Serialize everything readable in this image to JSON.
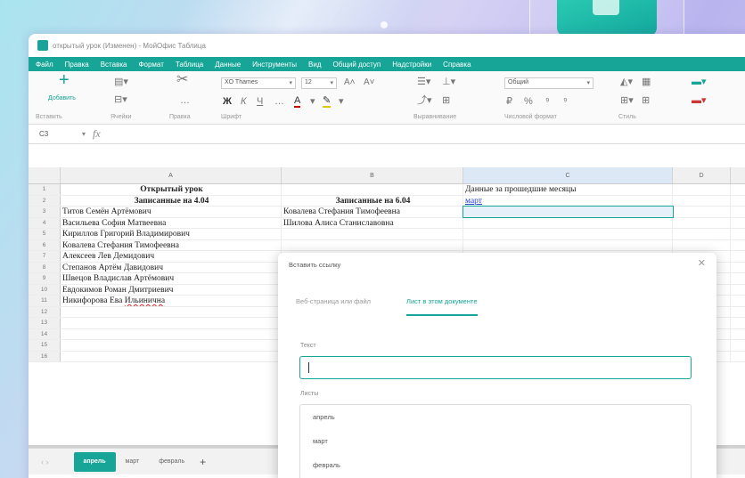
{
  "window_title": "открытый урок (Изменен) - МойОфис Таблица",
  "menu": [
    "Файл",
    "Правка",
    "Вставка",
    "Формат",
    "Таблица",
    "Данные",
    "Инструменты",
    "Вид",
    "Общий доступ",
    "Надстройки",
    "Справка"
  ],
  "ribbon": {
    "add_label": "Добавить",
    "font_name": "XO Thames",
    "font_size": "12",
    "number_format": "Общий",
    "groups": {
      "insert": "Вставить",
      "cells": "Ячейки",
      "clipboard": "Правка",
      "font": "Шрифт",
      "alignment": "Выравнивание",
      "number": "Числовой формат",
      "style": "Стиль"
    }
  },
  "formula_bar": {
    "cell_ref": "C3",
    "fx": "fx"
  },
  "columns": [
    "A",
    "B",
    "C",
    "D"
  ],
  "rows": [
    {
      "n": "1",
      "a": "Открытый урок",
      "b": "",
      "c": "Данные за прошедшие месяцы",
      "a_bold": true
    },
    {
      "n": "2",
      "a": "Записанные на 4.04",
      "b": "Записанные  на 6.04",
      "c": "март",
      "a_bold": true,
      "b_bold": true,
      "c_link": true
    },
    {
      "n": "3",
      "a": "Титов Семён Артёмович",
      "b": "Ковалева Стефания Тимофеевна",
      "c": "",
      "c_sel": true
    },
    {
      "n": "4",
      "a": "Васильева София Матвеевна",
      "b": "Шилова Алиса Станиславовна",
      "c": ""
    },
    {
      "n": "5",
      "a": "Кириллов Григорий Владимирович",
      "b": "",
      "c": ""
    },
    {
      "n": "6",
      "a": "Ковалева Стефания Тимофеевна",
      "b": "",
      "c": ""
    },
    {
      "n": "7",
      "a": "Алексеев Лев Демидович",
      "b": "",
      "c": ""
    },
    {
      "n": "8",
      "a": "Степанов Артём Давидович",
      "b": "",
      "c": ""
    },
    {
      "n": "9",
      "a": "Швецов Владислав Артёмович",
      "b": "",
      "c": ""
    },
    {
      "n": "10",
      "a": "Евдокимов Роман Дмитриевич",
      "b": "",
      "c": ""
    },
    {
      "n": "11",
      "a": "Никифорова Ева ",
      "a_err": "Ильинична",
      "b": "",
      "c": ""
    },
    {
      "n": "12",
      "a": "",
      "b": "",
      "c": ""
    },
    {
      "n": "13",
      "a": "",
      "b": "",
      "c": ""
    },
    {
      "n": "14",
      "a": "",
      "b": "",
      "c": ""
    },
    {
      "n": "15",
      "a": "",
      "b": "",
      "c": ""
    },
    {
      "n": "16",
      "a": "",
      "b": "",
      "c": ""
    }
  ],
  "sheets": [
    {
      "name": "апрель",
      "active": true
    },
    {
      "name": "март",
      "active": false
    },
    {
      "name": "февраль",
      "active": false
    }
  ],
  "add_sheet": "+",
  "dialog": {
    "title": "Вставить ссылку",
    "tabs": [
      {
        "label": "Веб-страница или файл",
        "active": false
      },
      {
        "label": "Лист в этом документе",
        "active": true
      }
    ],
    "text_label": "Текст",
    "text_value": "",
    "sheets_label": "Листы",
    "sheet_options": [
      "апрель",
      "март",
      "февраль"
    ]
  },
  "colors": {
    "accent": "#16a596",
    "link": "#2241c9"
  }
}
